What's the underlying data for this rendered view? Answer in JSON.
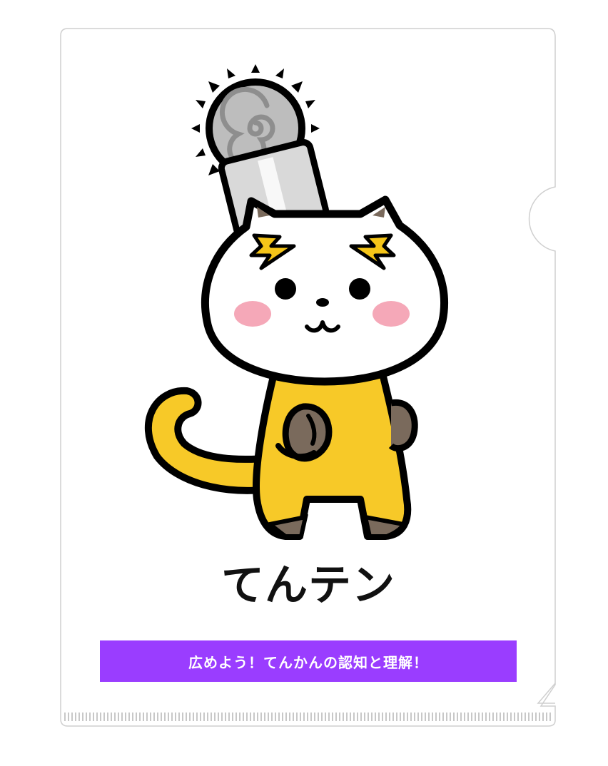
{
  "character": {
    "name": "てんテン"
  },
  "banner": {
    "text": "広めよう！てんかんの認知と理解！"
  },
  "colors": {
    "banner_bg": "#9a3dff",
    "body_yellow": "#f7c928",
    "paw_brown": "#7a6a5c",
    "cheek_pink": "#f5a8b8",
    "bolt_yellow": "#f5c518",
    "saw_gray": "#b8b8b8"
  },
  "icons": [
    "file-folder-icon",
    "chainsaw-icon",
    "lightning-bolt-icon"
  ]
}
